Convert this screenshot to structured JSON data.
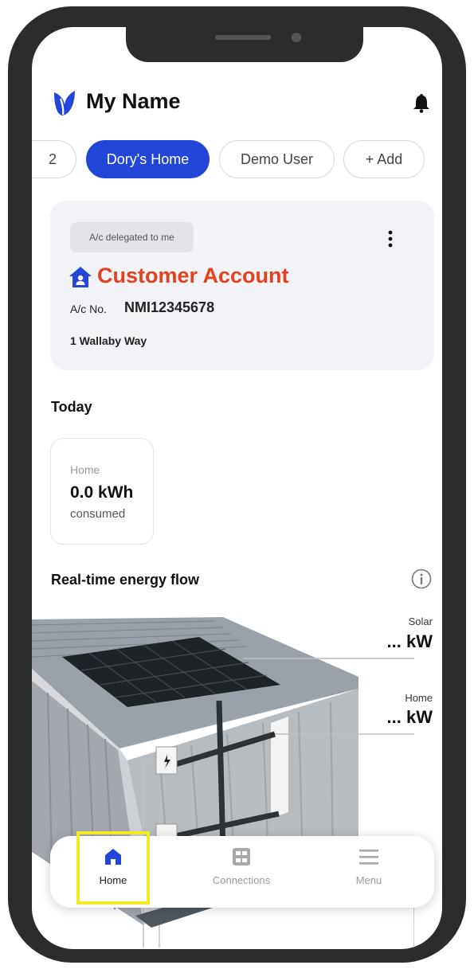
{
  "header": {
    "title": "My Name",
    "logo_icon": "leaf-logo-icon",
    "bell_icon": "bell-icon"
  },
  "accounts_tabs": [
    {
      "label": "2",
      "active": false
    },
    {
      "label": "Dory's Home",
      "active": true
    },
    {
      "label": "Demo User",
      "active": false
    },
    {
      "label": "+ Add",
      "active": false
    }
  ],
  "account_card": {
    "badge": "A/c delegated to me",
    "title": "Customer Account",
    "account_no_label": "A/c No.",
    "account_no": "NMI12345678",
    "address": "1 Wallaby Way"
  },
  "today": {
    "heading": "Today",
    "label": "Home",
    "value": "0.0 kWh",
    "sub": "consumed"
  },
  "energy_flow": {
    "heading": "Real-time energy flow",
    "solar_label": "Solar",
    "solar_value": "... kW",
    "home_label": "Home",
    "home_value": "... kW"
  },
  "nav": [
    {
      "label": "Home",
      "icon": "home-icon",
      "active": true
    },
    {
      "label": "Connections",
      "icon": "connections-icon",
      "active": false
    },
    {
      "label": "Menu",
      "icon": "menu-icon",
      "active": false
    }
  ],
  "colors": {
    "accent": "#2446d8",
    "title_red": "#e8401f",
    "highlight": "#f3ea26"
  }
}
